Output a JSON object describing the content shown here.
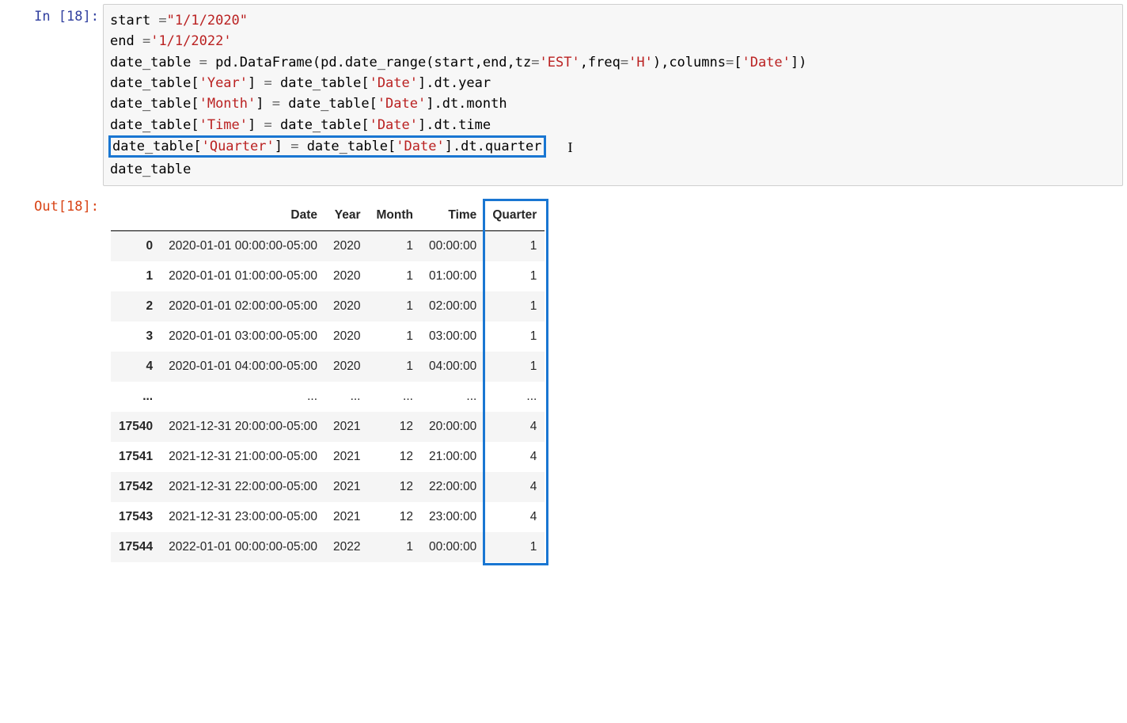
{
  "prompt_in": "In [18]:",
  "prompt_out": "Out[18]:",
  "code": {
    "l1_a": "start ",
    "l1_b": "=",
    "l1_c": "\"1/1/2020\"",
    "l2_a": "end ",
    "l2_b": "=",
    "l2_c": "'1/1/2022'",
    "l3_a": "date_table ",
    "l3_b": "=",
    "l3_c": " pd.DataFrame(pd.date_range(start,end,tz",
    "l3_d": "=",
    "l3_e": "'EST'",
    "l3_f": ",freq",
    "l3_g": "=",
    "l3_h": "'H'",
    "l3_i": "),columns",
    "l3_j": "=",
    "l3_k": "[",
    "l3_l": "'Date'",
    "l3_m": "])",
    "l4_a": "date_table[",
    "l4_b": "'Year'",
    "l4_c": "] ",
    "l4_d": "=",
    "l4_e": " date_table[",
    "l4_f": "'Date'",
    "l4_g": "].dt.year",
    "l5_a": "date_table[",
    "l5_b": "'Month'",
    "l5_c": "] ",
    "l5_d": "=",
    "l5_e": " date_table[",
    "l5_f": "'Date'",
    "l5_g": "].dt.month",
    "l6_a": "date_table[",
    "l6_b": "'Time'",
    "l6_c": "] ",
    "l6_d": "=",
    "l6_e": " date_table[",
    "l6_f": "'Date'",
    "l6_g": "].dt.time",
    "l7_a": "date_table[",
    "l7_b": "'Quarter'",
    "l7_c": "] ",
    "l7_d": "=",
    "l7_e": " date_table[",
    "l7_f": "'Date'",
    "l7_g": "].dt.quarter",
    "l8": "date_table",
    "cursor": "I"
  },
  "table": {
    "columns": [
      "",
      "Date",
      "Year",
      "Month",
      "Time",
      "Quarter"
    ],
    "rows": [
      {
        "idx": "0",
        "date": "2020-01-01 00:00:00-05:00",
        "year": "2020",
        "month": "1",
        "time": "00:00:00",
        "q": "1"
      },
      {
        "idx": "1",
        "date": "2020-01-01 01:00:00-05:00",
        "year": "2020",
        "month": "1",
        "time": "01:00:00",
        "q": "1"
      },
      {
        "idx": "2",
        "date": "2020-01-01 02:00:00-05:00",
        "year": "2020",
        "month": "1",
        "time": "02:00:00",
        "q": "1"
      },
      {
        "idx": "3",
        "date": "2020-01-01 03:00:00-05:00",
        "year": "2020",
        "month": "1",
        "time": "03:00:00",
        "q": "1"
      },
      {
        "idx": "4",
        "date": "2020-01-01 04:00:00-05:00",
        "year": "2020",
        "month": "1",
        "time": "04:00:00",
        "q": "1"
      },
      {
        "idx": "...",
        "date": "...",
        "year": "...",
        "month": "...",
        "time": "...",
        "q": "..."
      },
      {
        "idx": "17540",
        "date": "2021-12-31 20:00:00-05:00",
        "year": "2021",
        "month": "12",
        "time": "20:00:00",
        "q": "4"
      },
      {
        "idx": "17541",
        "date": "2021-12-31 21:00:00-05:00",
        "year": "2021",
        "month": "12",
        "time": "21:00:00",
        "q": "4"
      },
      {
        "idx": "17542",
        "date": "2021-12-31 22:00:00-05:00",
        "year": "2021",
        "month": "12",
        "time": "22:00:00",
        "q": "4"
      },
      {
        "idx": "17543",
        "date": "2021-12-31 23:00:00-05:00",
        "year": "2021",
        "month": "12",
        "time": "23:00:00",
        "q": "4"
      },
      {
        "idx": "17544",
        "date": "2022-01-01 00:00:00-05:00",
        "year": "2022",
        "month": "1",
        "time": "00:00:00",
        "q": "1"
      }
    ]
  }
}
